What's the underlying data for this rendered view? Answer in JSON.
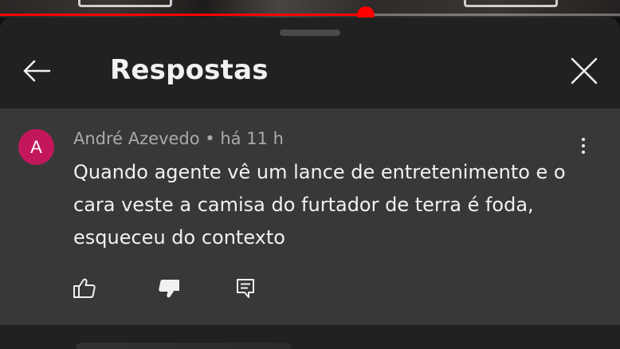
{
  "playback": {
    "progress_fraction": 0.59,
    "accent_color": "#ff0000"
  },
  "header": {
    "title": "Respostas",
    "back_icon": "arrow-left-icon",
    "close_icon": "close-icon"
  },
  "comment": {
    "avatar_letter": "A",
    "avatar_color": "#c2185b",
    "author": "André Azevedo",
    "separator": " • ",
    "time": "há 11 h",
    "text": "Quando agente vê um lance de entretenimento e o cara veste a camisa do furtador de terra é foda, esqueceu do contexto",
    "more_icon": "more-vert-icon",
    "actions": {
      "like_icon": "thumb-up-outline-icon",
      "dislike_icon": "thumb-down-filled-icon",
      "reply_icon": "reply-comment-icon"
    }
  }
}
